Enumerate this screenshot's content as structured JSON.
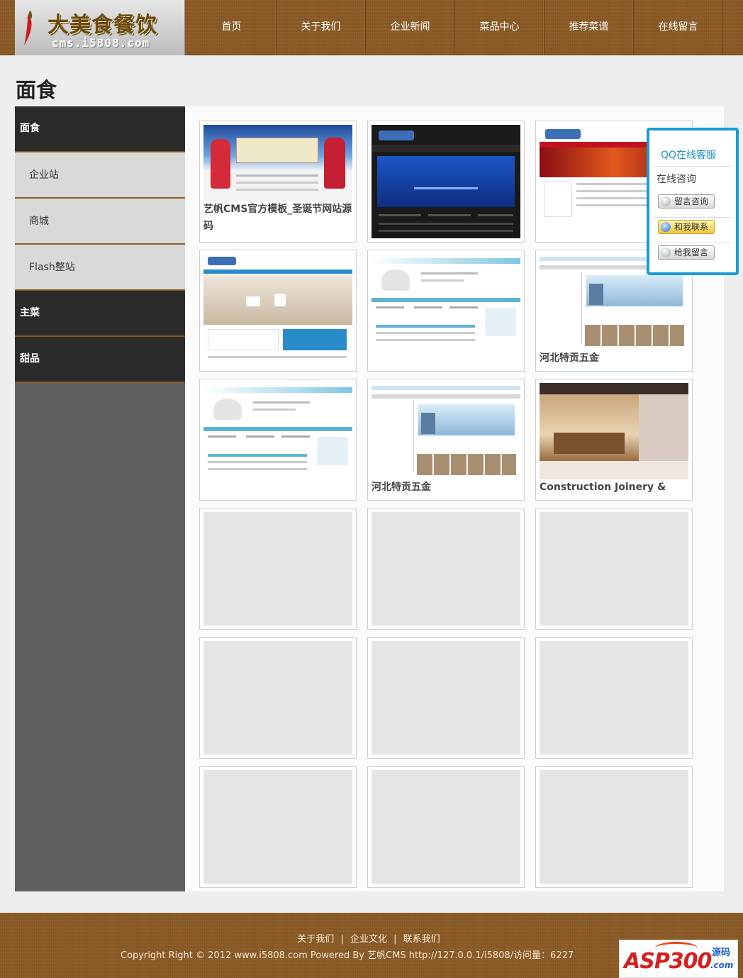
{
  "logo": {
    "title": "大美食餐饮",
    "subtitle": "cms.i5808.com"
  },
  "nav": [
    {
      "label": "首页"
    },
    {
      "label": "关于我们"
    },
    {
      "label": "企业新闻"
    },
    {
      "label": "菜品中心"
    },
    {
      "label": "推荐菜谱"
    },
    {
      "label": "在线留言"
    }
  ],
  "page_title": "面食",
  "sidebar": [
    {
      "label": "面食",
      "level": "top"
    },
    {
      "label": "企业站",
      "level": "sub"
    },
    {
      "label": "商城",
      "level": "sub"
    },
    {
      "label": "Flash整站",
      "level": "sub"
    },
    {
      "label": "主菜",
      "level": "top"
    },
    {
      "label": "甜品",
      "level": "top"
    }
  ],
  "products": [
    {
      "caption": "艺帆CMS官方模板_圣诞节网站源码",
      "thumb": "christmas"
    },
    {
      "caption": "",
      "thumb": "dark-blue"
    },
    {
      "caption": "",
      "thumb": "red-dragon"
    },
    {
      "caption": "",
      "thumb": "kitchen"
    },
    {
      "caption": "",
      "thumb": "laptop-man"
    },
    {
      "caption": "河北特贡五金",
      "thumb": "building"
    },
    {
      "caption": "",
      "thumb": "laptop-man"
    },
    {
      "caption": "河北特贡五金",
      "thumb": "building"
    },
    {
      "caption": "Construction Joinery &",
      "thumb": "interior"
    },
    {
      "caption": "",
      "thumb": "empty"
    },
    {
      "caption": "",
      "thumb": "empty"
    },
    {
      "caption": "",
      "thumb": "empty"
    },
    {
      "caption": "",
      "thumb": "empty"
    },
    {
      "caption": "",
      "thumb": "empty"
    },
    {
      "caption": "",
      "thumb": "empty"
    },
    {
      "caption": "",
      "thumb": "empty"
    },
    {
      "caption": "",
      "thumb": "empty"
    },
    {
      "caption": "",
      "thumb": "empty"
    }
  ],
  "qq_panel": {
    "title": "QQ在线客服",
    "label": "在线咨询",
    "buttons": [
      {
        "label": "留言咨询",
        "style": "gray"
      },
      {
        "label": "和我联系",
        "style": "yellow"
      },
      {
        "label": "给我留言",
        "style": "gray"
      }
    ]
  },
  "footer": {
    "links": [
      {
        "label": "关于我们"
      },
      {
        "label": "企业文化"
      },
      {
        "label": "联系我们"
      }
    ],
    "separator": "|",
    "copyright": "Copyright Right © 2012 www.i5808.com Powered By 艺帆CMS http://127.0.0.1/i5808/访问量：6227",
    "badge": {
      "text": "ASP300",
      "code": "源码",
      "com": ".com"
    }
  },
  "colors": {
    "wood": "#8a5a25",
    "sidebar_dark": "#2b2b2b",
    "sidebar_light": "#d9d9d9",
    "qq_border": "#1a9bd8"
  }
}
